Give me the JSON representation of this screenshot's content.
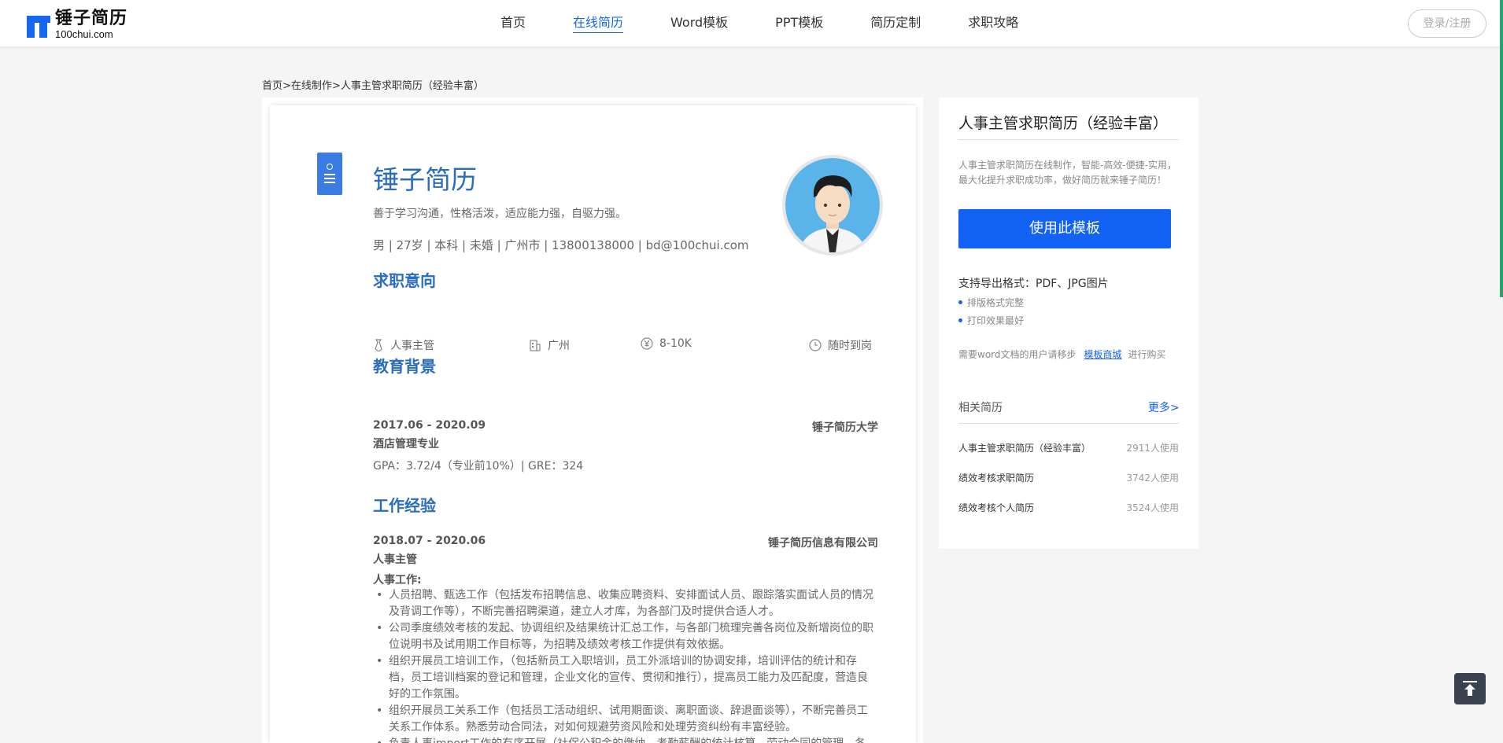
{
  "header": {
    "logo_cn": "锤子简历",
    "logo_en": "100chui.com",
    "nav": [
      "首页",
      "在线简历",
      "Word模板",
      "PPT模板",
      "简历定制",
      "求职攻略"
    ],
    "active_nav": "在线简历",
    "login_label": "登录/注册"
  },
  "breadcrumb": {
    "home": "首页",
    "sep1": ">",
    "section": "在线制作",
    "sep2": ">",
    "current": "人事主管求职简历（经验丰富）"
  },
  "resume": {
    "name": "锤子简历",
    "motto": "善于学习沟通，性格活泼，适应能力强，自驱力强。",
    "info": "男 |  27岁 |  本科 |  未婚 |  广州市 |  13800138000 |  bd@100chui.com",
    "intent_title": "求职意向",
    "intent": {
      "position": "人事主管",
      "city": "广州",
      "salary": "8-10K",
      "availability": "随时到岗"
    },
    "edu_title": "教育背景",
    "edu": {
      "period": "2017.06 - 2020.09",
      "school": "锤子简历大学",
      "major": "酒店管理专业",
      "detail": "GPA：3.72/4（专业前10%）| GRE：324"
    },
    "work_title": "工作经验",
    "work": {
      "period": "2018.07 - 2020.06",
      "company": "锤子简历信息有限公司",
      "role": "人事主管",
      "subhead": "人事工作:",
      "items": [
        " 人员招聘、甄选工作（包括发布招聘信息、收集应聘资料、安排面试人员、跟踪落实面试人员的情况及背调工作等），不断完善招聘渠道，建立人才库，为各部门及时提供合适人才。",
        "公司季度绩效考核的发起、协调组织及结果统计汇总工作，与各部门梳理完善各岗位及新增岗位的职位说明书及试用期工作目标等，为招聘及绩效考核工作提供有效依据。",
        "组织开展员工培训工作，（包括新员工入职培训，员工外派培训的协调安排，培训评估的统计和存档，员工培训档案的登记和管理，企业文化的宣传、贯彻和推行），提高员工能力及匹配度，营造良好的工作氛围。",
        "组织开展员工关系工作（包括员工活动组织、试用期面谈、离职面谈、辞退面谈等），不断完善员工关系工作体系。熟悉劳动合同法，对如何规避劳资风险和处理劳资纠纷有丰富经验。",
        "负责人事import工作的有序开展（社保公积金的缴纳，考勤薪酬的统计核算，劳动合同的管理，各种员"
      ]
    }
  },
  "sidebar": {
    "title": "人事主管求职简历（经验丰富）",
    "desc": "人事主管求职简历在线制作，智能-高效-便捷-实用，最大化提升求职成功率，做好简历就来锤子简历！",
    "use_button": "使用此模板",
    "formats": "支持导出格式：PDF、JPG图片",
    "features": [
      "排版格式完整",
      "打印效果最好"
    ],
    "word_tip_prefix": "需要word文档的用户请移步",
    "word_tip_link": "模板商城",
    "word_tip_suffix": "进行购买",
    "related_title": "相关简历",
    "more_label": "更多>",
    "related": [
      {
        "title": "人事主管求职简历（经验丰富）",
        "count": "2911人使用"
      },
      {
        "title": "绩效考核求职简历",
        "count": "3742人使用"
      },
      {
        "title": "绩效考核个人简历",
        "count": "3524人使用"
      }
    ]
  },
  "colors": {
    "brand": "#1666f0",
    "resume_accent": "#2a6dbf",
    "button": "#1162f5"
  }
}
